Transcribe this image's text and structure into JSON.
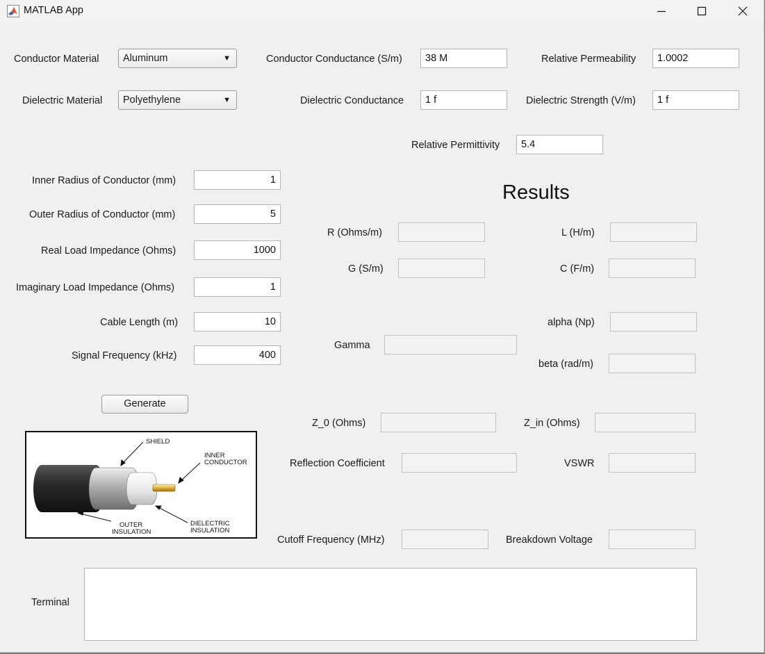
{
  "window": {
    "title": "MATLAB App"
  },
  "materials": {
    "conductor_label": "Conductor Material",
    "conductor_value": "Aluminum",
    "dielectric_label": "Dielectric Material",
    "dielectric_value": "Polyethylene",
    "conductance_label": "Conductor Conductance (S/m)",
    "conductance_value": "38 M",
    "permeability_label": "Relative Permeability",
    "permeability_value": "1.0002",
    "diel_conductance_label": "Dielectric Conductance",
    "diel_conductance_value": "1 f",
    "diel_strength_label": "Dielectric Strength (V/m)",
    "diel_strength_value": "1 f",
    "permittivity_label": "Relative Permittivity",
    "permittivity_value": "5.4"
  },
  "inputs": {
    "inner_radius_label": "Inner Radius of Conductor (mm)",
    "inner_radius_value": "1",
    "outer_radius_label": "Outer Radius of Conductor (mm)",
    "outer_radius_value": "5",
    "real_load_label": "Real Load Impedance (Ohms)",
    "real_load_value": "1000",
    "imag_load_label": "Imaginary Load Impedance (Ohms)",
    "imag_load_value": "1",
    "cable_length_label": "Cable Length (m)",
    "cable_length_value": "10",
    "frequency_label": "Signal Frequency (kHz)",
    "frequency_value": "400"
  },
  "generate_label": "Generate",
  "diagram": {
    "shield": "SHIELD",
    "inner_conductor_1": "INNER",
    "inner_conductor_2": "CONDUCTOR",
    "outer_insulation_1": "OUTER",
    "outer_insulation_2": "INSULATION",
    "dielectric_insulation_1": "DIELECTRIC",
    "dielectric_insulation_2": "INSULATION"
  },
  "results": {
    "title": "Results",
    "R": {
      "label": "R (Ohms/m)",
      "value": ""
    },
    "L": {
      "label": "L (H/m)",
      "value": ""
    },
    "G": {
      "label": "G (S/m)",
      "value": ""
    },
    "C": {
      "label": "C (F/m)",
      "value": ""
    },
    "alpha": {
      "label": "alpha (Np)",
      "value": ""
    },
    "gamma": {
      "label": "Gamma",
      "value": ""
    },
    "beta": {
      "label": "beta (rad/m)",
      "value": ""
    },
    "z0": {
      "label": "Z_0 (Ohms)",
      "value": ""
    },
    "zin": {
      "label": "Z_in (Ohms)",
      "value": ""
    },
    "reflection": {
      "label": "Reflection Coefficient",
      "value": ""
    },
    "vswr": {
      "label": "VSWR",
      "value": ""
    },
    "cutoff": {
      "label": "Cutoff Frequency (MHz)",
      "value": ""
    },
    "breakdown": {
      "label": "Breakdown Voltage",
      "value": ""
    }
  },
  "terminal": {
    "label": "Terminal",
    "text": ""
  }
}
